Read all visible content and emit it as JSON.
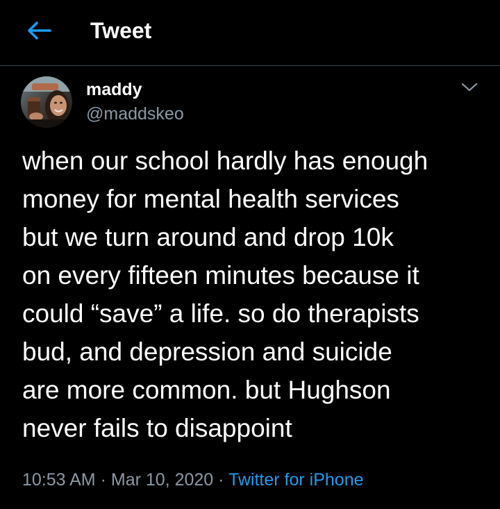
{
  "header": {
    "title": "Tweet"
  },
  "author": {
    "display_name": "maddy",
    "handle": "@maddskeo"
  },
  "tweet": {
    "lines": [
      "when our school hardly has enough",
      "money for mental health services",
      "but we turn around and drop 10k",
      "on every fifteen minutes because it",
      "could “save” a life. so do therapists",
      "bud, and depression and suicide",
      "are more common. but Hughson",
      "never fails to disappoint"
    ],
    "time": "10:53 AM",
    "date": "Mar 10, 2020",
    "separator": "·",
    "source": "Twitter for iPhone"
  },
  "icons": {
    "back": "arrow-left-icon",
    "caret": "chevron-down-icon"
  },
  "colors": {
    "background": "#000000",
    "accent": "#1d9bf0",
    "secondary_text": "#8b98a5",
    "divider": "#38444d"
  }
}
